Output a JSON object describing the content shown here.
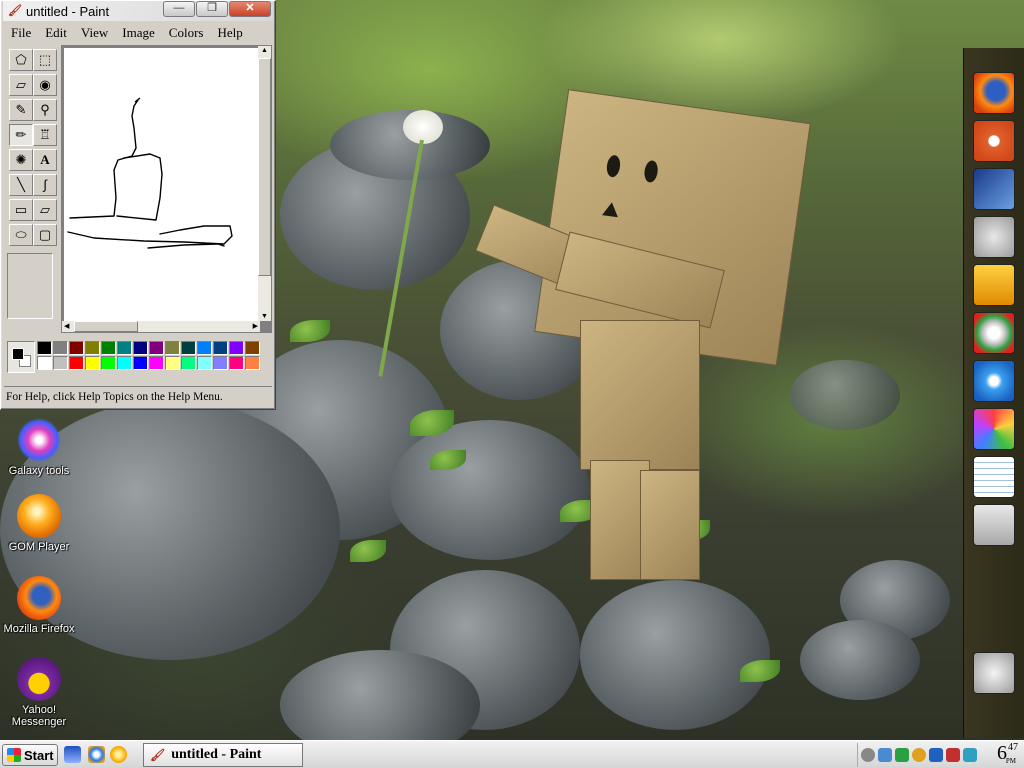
{
  "paint": {
    "title": "untitled - Paint",
    "window_buttons": {
      "minimize": "—",
      "maximize": "❐",
      "close": "✕"
    },
    "menu": [
      "File",
      "Edit",
      "View",
      "Image",
      "Colors",
      "Help"
    ],
    "tools": [
      "free-form-select",
      "rectangle-select",
      "eraser",
      "fill-with-color",
      "pick-color",
      "magnifier",
      "pencil",
      "brush",
      "airbrush",
      "text",
      "line",
      "curve",
      "rectangle",
      "polygon",
      "ellipse",
      "rounded-rectangle"
    ],
    "active_tool": "pencil",
    "palette": [
      "#000000",
      "#808080",
      "#800000",
      "#808000",
      "#008000",
      "#008080",
      "#000080",
      "#800080",
      "#808040",
      "#004040",
      "#0080ff",
      "#004080",
      "#8000ff",
      "#804000",
      "#ffffff",
      "#c0c0c0",
      "#ff0000",
      "#ffff00",
      "#00ff00",
      "#00ffff",
      "#0000ff",
      "#ff00ff",
      "#ffff80",
      "#00ff80",
      "#80ffff",
      "#8080ff",
      "#ff0080",
      "#ff8040"
    ],
    "foreground_color": "#000000",
    "background_color": "#ffffff",
    "status": "For Help, click Help Topics on the Help Menu."
  },
  "desktop_icons": [
    {
      "label": "Galaxy tools"
    },
    {
      "label": "GOM Player"
    },
    {
      "label": "Mozilla Firefox"
    },
    {
      "label": "Yahoo! Messenger"
    }
  ],
  "dock": [
    "firefox-icon",
    "ubuntu-icon",
    "display-settings-icon",
    "gears-icon",
    "users-icon",
    "disc-icon",
    "itunes-icon",
    "paint-palette-icon",
    "notepad-icon",
    "calculator-icon",
    "recycle-bin-icon"
  ],
  "taskbar": {
    "start_label": "Start",
    "task_title": "untitled - Paint",
    "clock_hour": "6",
    "clock_minute": "47",
    "clock_ampm": "PM"
  }
}
